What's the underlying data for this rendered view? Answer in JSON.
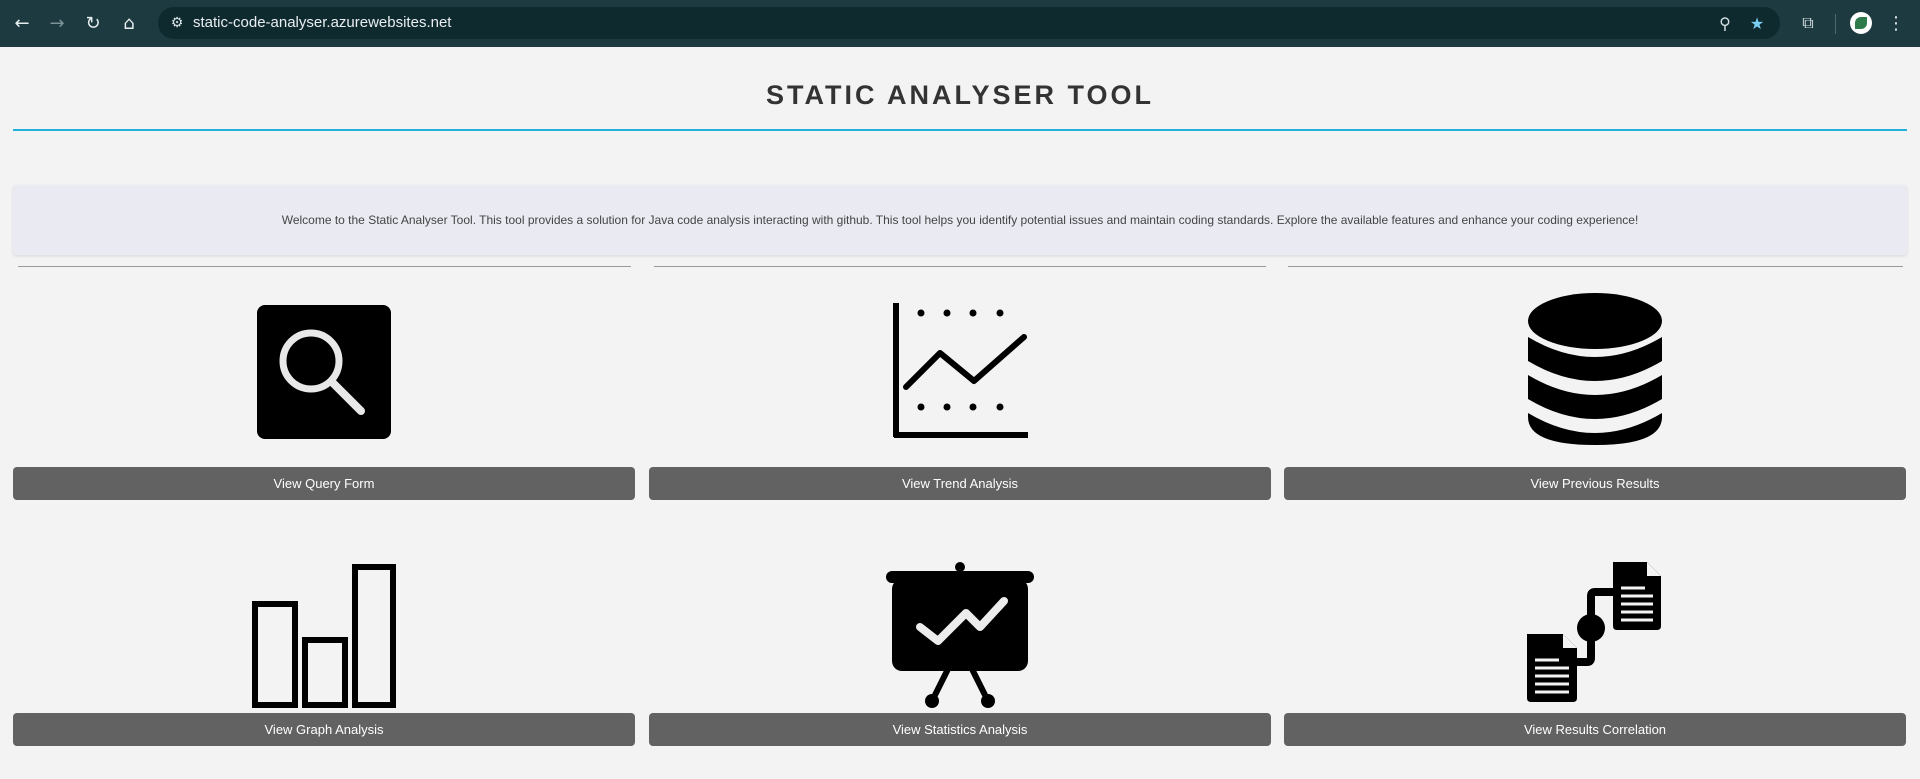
{
  "browser": {
    "url": "static-code-analyser.azurewebsites.net",
    "back_icon": "←",
    "forward_icon": "→",
    "reload_icon": "↻",
    "home_icon": "⌂",
    "zoom_icon": "⚲",
    "star_icon": "★",
    "extensions_icon": "⧉",
    "menu_icon": "⋮",
    "site_info_icon": "⚙"
  },
  "page": {
    "title": "STATIC ANALYSER TOOL",
    "welcome": "Welcome to the Static Analyser Tool. This tool provides a solution for Java code analysis interacting with github. This tool helps you identify potential issues and maintain coding standards. Explore the available features and enhance your coding experience!"
  },
  "cards": [
    {
      "label": "View Query Form",
      "icon": "search-icon"
    },
    {
      "label": "View Trend Analysis",
      "icon": "trend-chart-icon"
    },
    {
      "label": "View Previous Results",
      "icon": "database-icon"
    },
    {
      "label": "View Graph Analysis",
      "icon": "bar-chart-icon"
    },
    {
      "label": "View Statistics Analysis",
      "icon": "presentation-chart-icon"
    },
    {
      "label": "View Results Correlation",
      "icon": "document-correlation-icon"
    }
  ],
  "colors": {
    "chrome_bg": "#1c3a40",
    "accent_rule": "#22b1db",
    "button_bg": "#626262",
    "page_bg": "#f3f3f3"
  }
}
